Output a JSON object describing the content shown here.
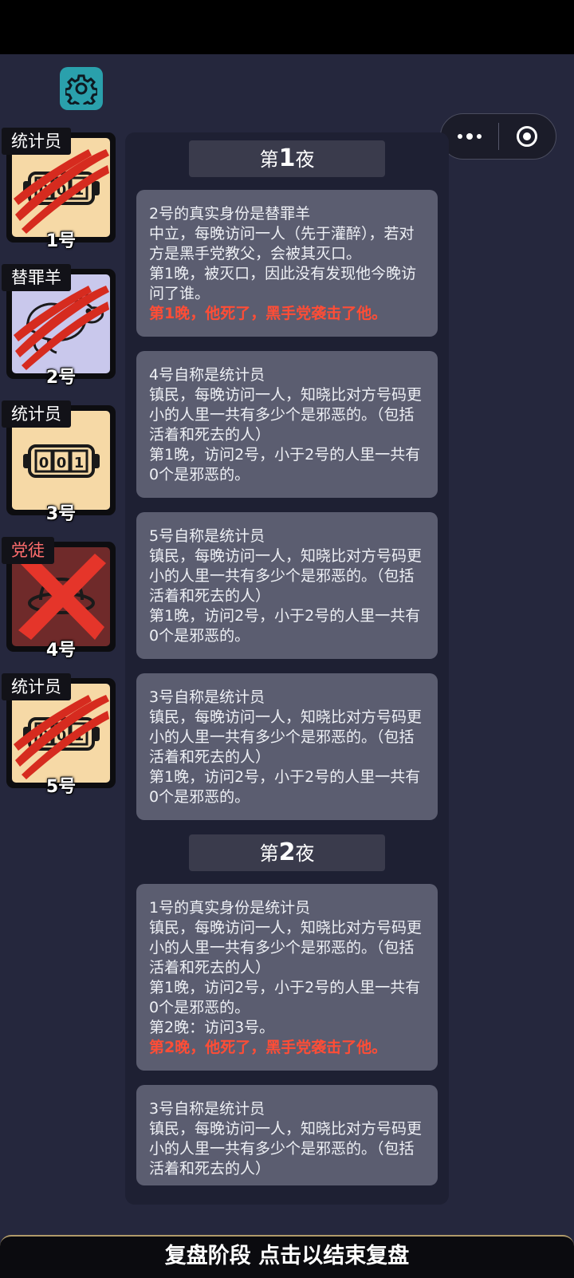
{
  "header": {
    "settings_icon": "gear-icon",
    "menu_icon": "more-dots-icon",
    "close_icon": "target-circle-icon"
  },
  "players": [
    {
      "number": "1号",
      "role": "统计员",
      "status": "dead-claw",
      "art": "counter"
    },
    {
      "number": "2号",
      "role": "替罪羊",
      "status": "dead-claw",
      "art": "goat"
    },
    {
      "number": "3号",
      "role": "统计员",
      "status": "alive",
      "art": "counter"
    },
    {
      "number": "4号",
      "role": "党徒",
      "status": "crossed",
      "art": "mafia"
    },
    {
      "number": "5号",
      "role": "统计员",
      "status": "dead-claw",
      "art": "counter"
    }
  ],
  "log": {
    "nights": [
      {
        "prefix": "第",
        "number": "1",
        "suffix": "夜",
        "messages": [
          {
            "lines": [
              "2号的真实身份是替罪羊",
              "中立，每晚访问一人（先于灌醉），若对方是黑手党教父，会被其灭口。",
              "第1晚，被灭口，因此没有发现他今晚访问了谁。"
            ],
            "kill": "第1晚，他死了，黑手党袭击了他。"
          },
          {
            "lines": [
              "4号自称是统计员",
              "镇民，每晚访问一人，知晓比对方号码更小的人里一共有多少个是邪恶的。（包括活着和死去的人）",
              "第1晚，访问2号，小于2号的人里一共有0个是邪恶的。"
            ]
          },
          {
            "lines": [
              "5号自称是统计员",
              "镇民，每晚访问一人，知晓比对方号码更小的人里一共有多少个是邪恶的。（包括活着和死去的人）",
              "第1晚，访问2号，小于2号的人里一共有0个是邪恶的。"
            ]
          },
          {
            "lines": [
              "3号自称是统计员",
              "镇民，每晚访问一人，知晓比对方号码更小的人里一共有多少个是邪恶的。（包括活着和死去的人）",
              "第1晚，访问2号，小于2号的人里一共有0个是邪恶的。"
            ]
          }
        ]
      },
      {
        "prefix": "第",
        "number": "2",
        "suffix": "夜",
        "messages": [
          {
            "lines": [
              "1号的真实身份是统计员",
              "镇民，每晚访问一人，知晓比对方号码更小的人里一共有多少个是邪恶的。（包括活着和死去的人）",
              "第1晚，访问2号，小于2号的人里一共有0个是邪恶的。",
              "第2晚：访问3号。"
            ],
            "kill": "第2晚，他死了，黑手党袭击了他。"
          },
          {
            "lines": [
              "3号自称是统计员",
              "镇民，每晚访问一人，知晓比对方号码更小的人里一共有多少个是邪恶的。（包括活着和死去的人）"
            ]
          }
        ]
      }
    ]
  },
  "footer": {
    "label": "复盘阶段 点击以结束复盘"
  }
}
